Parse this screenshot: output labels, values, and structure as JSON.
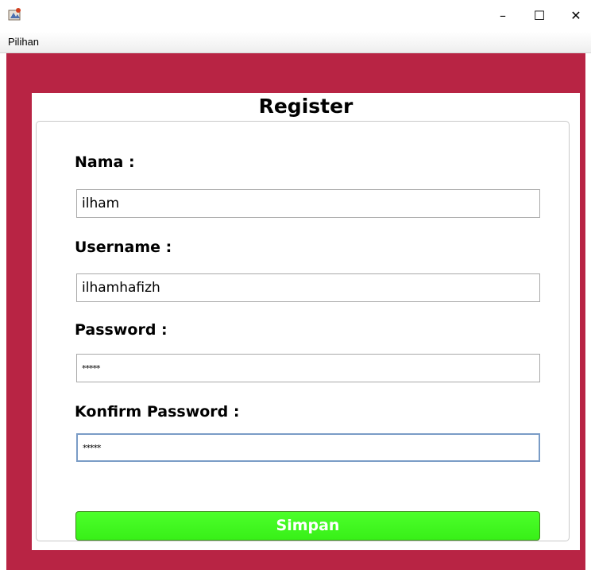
{
  "window": {
    "icon": "java-app-icon",
    "controls": {
      "minimize": "–",
      "maximize": "☐",
      "close": "✕"
    }
  },
  "menubar": {
    "items": [
      {
        "label": "Pilihan"
      }
    ]
  },
  "form": {
    "title": "Register",
    "fields": {
      "nama": {
        "label": "Nama :",
        "value": "ilham"
      },
      "username": {
        "label": "Username :",
        "value": "ilhamhafizh"
      },
      "password": {
        "label": "Password :",
        "value": "*****"
      },
      "konfirm": {
        "label": "Konfirm Password :",
        "value": "*****"
      }
    },
    "submit_label": "Simpan"
  },
  "colors": {
    "background": "#b82444",
    "button": "#40f51f"
  }
}
